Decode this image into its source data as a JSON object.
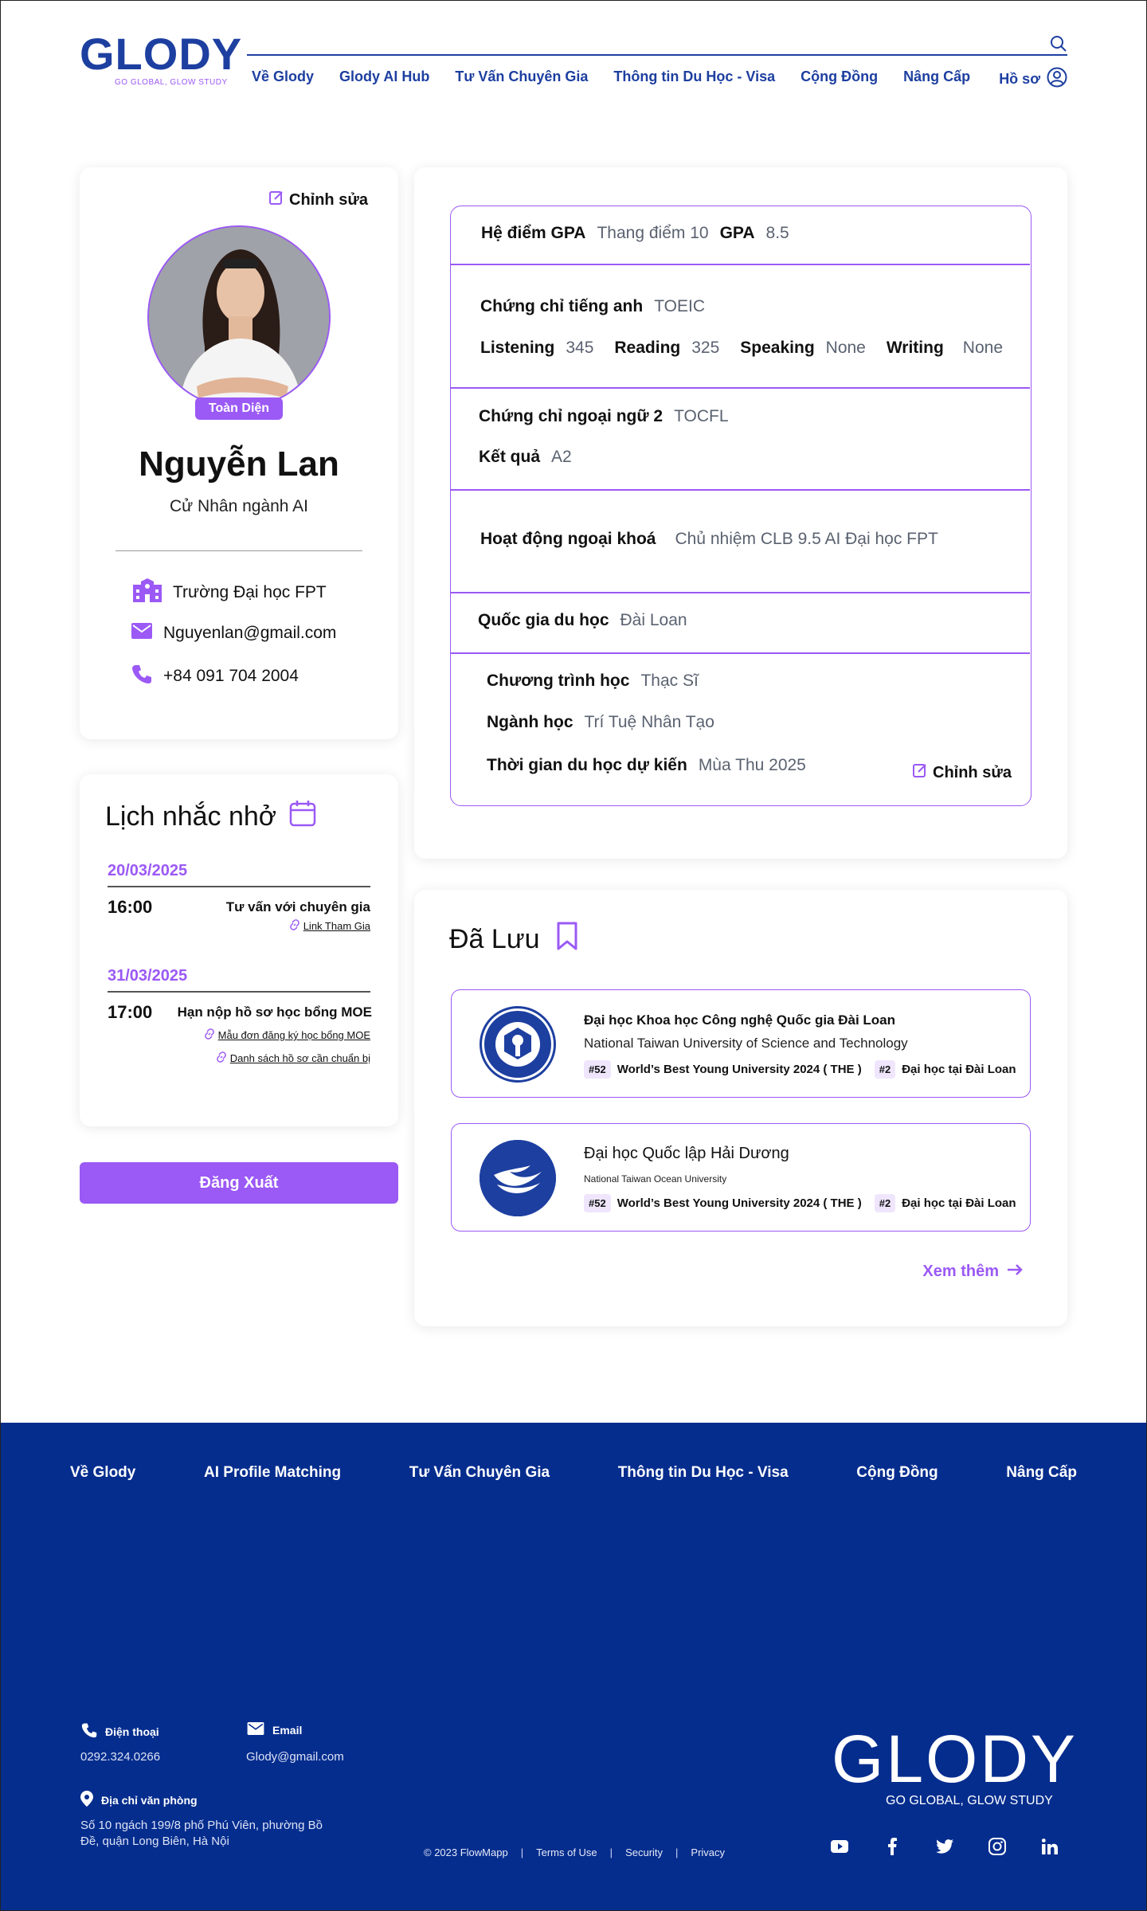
{
  "header": {
    "logo": "GLODY",
    "logo_tagline": "GO GLOBAL, GLOW STUDY",
    "nav": [
      "Về Glody",
      "Glody AI Hub",
      "Tư Vấn Chuyên Gia",
      "Thông tin Du Học - Visa",
      "Cộng Đồng",
      "Nâng Cấp"
    ],
    "profile_label": "Hồ sơ"
  },
  "profile": {
    "edit_label": "Chỉnh sửa",
    "badge": "Toàn Diện",
    "name": "Nguyễn Lan",
    "degree": "Cử Nhân ngành AI",
    "school": "Trường Đại học FPT",
    "email": "Nguyenlan@gmail.com",
    "phone": "+84 091 704 2004"
  },
  "reminders": {
    "title": "Lịch nhắc nhở",
    "groups": [
      {
        "date": "20/03/2025",
        "time": "16:00",
        "text": "Tư vấn với chuyên gia",
        "links": [
          "Link Tham Gia"
        ]
      },
      {
        "date": "31/03/2025",
        "time": "17:00",
        "text": "Hạn nộp hồ sơ học bổng MOE",
        "links": [
          "Mẫu đơn đăng ký học bổng MOE",
          "Danh sách hồ sơ cần chuẩn bị"
        ]
      }
    ]
  },
  "logout_label": "Đăng Xuất",
  "info": {
    "gpa_system_label": "Hệ điểm GPA",
    "gpa_system_value": "Thang điểm 10",
    "gpa_label": "GPA",
    "gpa_value": "8.5",
    "english_cert_label": "Chứng chỉ tiếng anh",
    "english_cert_value": "TOEIC",
    "listening_label": "Listening",
    "listening_value": "345",
    "reading_label": "Reading",
    "reading_value": "325",
    "speaking_label": "Speaking",
    "speaking_value": "None",
    "writing_label": "Writing",
    "writing_value": "None",
    "second_lang_label": "Chứng chỉ ngoại ngữ 2",
    "second_lang_value": "TOCFL",
    "result_label": "Kết quả",
    "result_value": "A2",
    "activities_label": "Hoạt động ngoại khoá",
    "activities_value": "Chủ nhiệm CLB 9.5 AI Đại học FPT",
    "country_label": "Quốc gia du học",
    "country_value": "Đài Loan",
    "program_label": "Chương trình học",
    "program_value": "Thạc Sĩ",
    "major_label": "Ngành học",
    "major_value": "Trí Tuệ Nhân Tạo",
    "time_label": "Thời gian du học dự kiến",
    "time_value": "Mùa Thu 2025",
    "edit_label": "Chỉnh sửa"
  },
  "saved": {
    "title": "Đã Lưu",
    "universities": [
      {
        "name": "Đại học Khoa học Công nghệ Quốc gia Đài Loan",
        "english": "National Taiwan University of Science and Technology",
        "rank1": "#52",
        "rank1_text": "World’s Best Young University 2024 ( THE )",
        "rank2": "#2",
        "rank2_text": "Đại học tại Đài Loan"
      },
      {
        "name": "Đại học Quốc lập Hải Dương",
        "english": "National Taiwan Ocean University",
        "rank1": "#52",
        "rank1_text": "World’s Best Young University 2024 ( THE )",
        "rank2": "#2",
        "rank2_text": "Đại học tại Đài Loan"
      }
    ],
    "see_more": "Xem thêm"
  },
  "footer": {
    "nav": [
      "Về Glody",
      "AI Profile Matching",
      "Tư Vấn Chuyên Gia",
      "Thông tin Du Học - Visa",
      "Cộng Đồng",
      "Nâng Cấp"
    ],
    "phone_label": "Điện thoại",
    "phone_value": "0292.324.0266",
    "email_label": "Email",
    "email_value": "Glody@gmail.com",
    "address_label": "Địa chỉ văn phòng",
    "address_value": "Số 10 ngách 199/8 phố Phú Viên, phường Bồ Đề, quận Long Biên, Hà Nội",
    "copyright": "© 2023 FlowMapp",
    "terms": "Terms of Use",
    "security": "Security",
    "privacy": "Privacy",
    "logo": "GLODY",
    "logo_tagline": "GO GLOBAL, GLOW STUDY"
  },
  "colors": {
    "brand_blue": "#1d3fa0",
    "accent_purple": "#9b59f5",
    "footer_blue": "#052d8e"
  }
}
